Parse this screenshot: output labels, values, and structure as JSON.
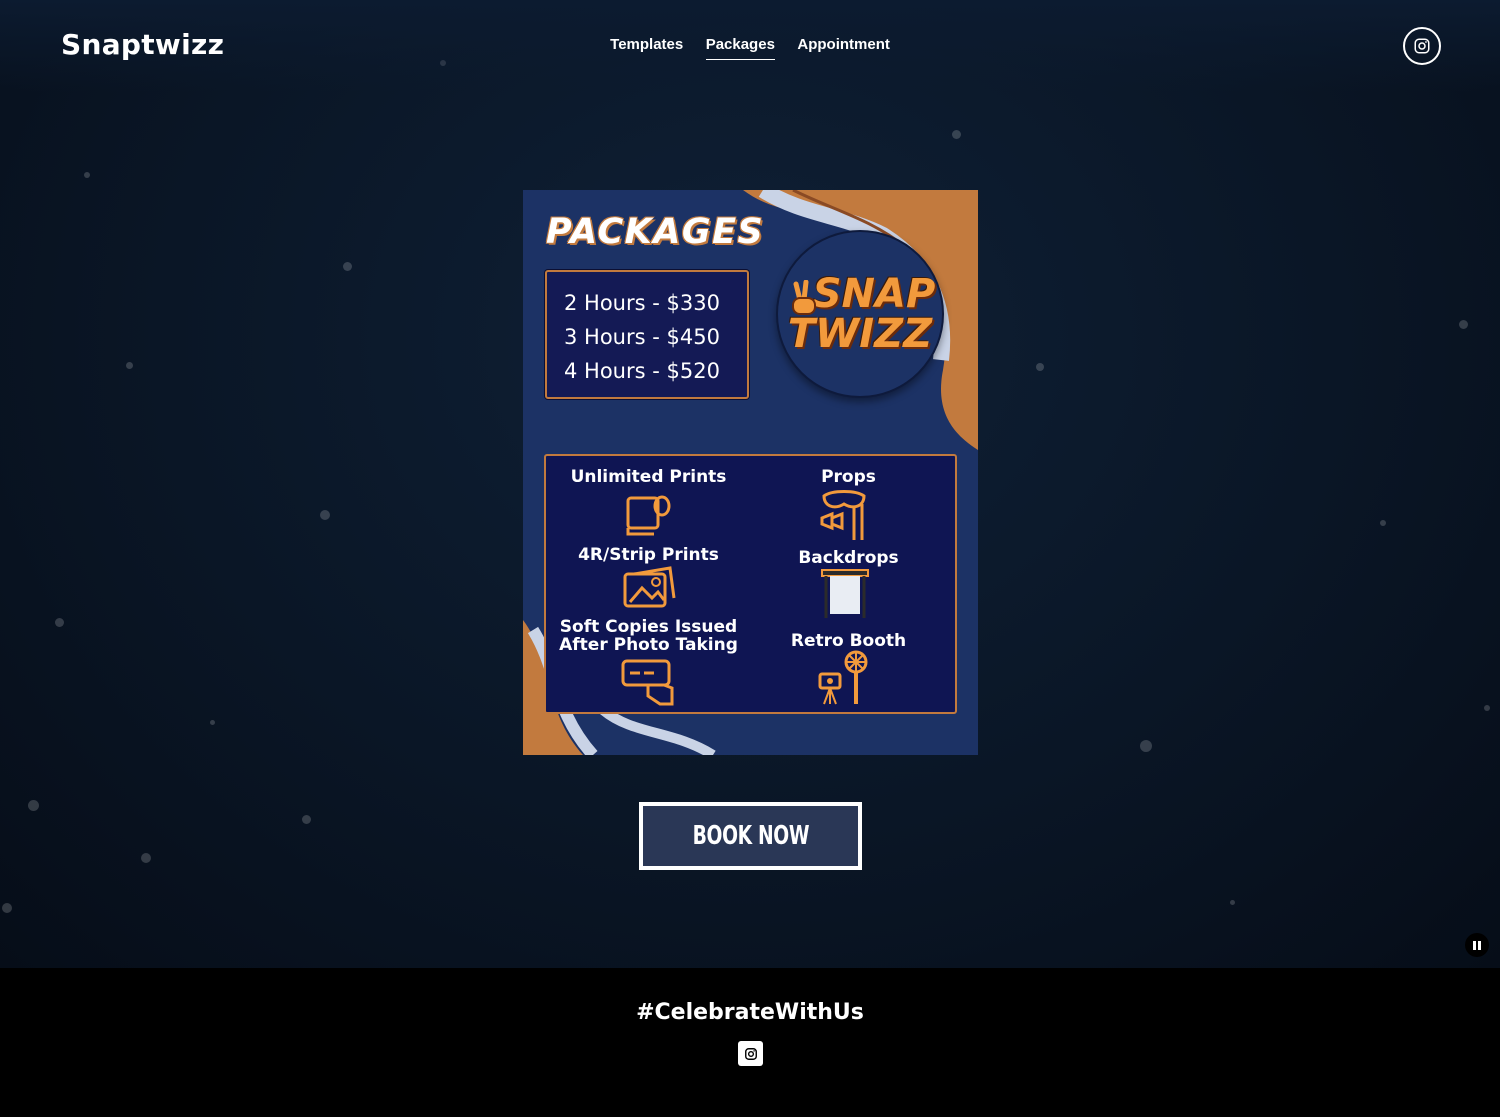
{
  "header": {
    "logo": "Snaptwizz",
    "nav": [
      {
        "label": "Templates",
        "active": false
      },
      {
        "label": "Packages",
        "active": true
      },
      {
        "label": "Appointment",
        "active": false
      }
    ],
    "social_icon": "instagram-icon"
  },
  "flyer": {
    "title": "PACKAGES",
    "prices": [
      "2 Hours - $330",
      "3 Hours - $450",
      "4 Hours - $520"
    ],
    "brand": [
      "SNAP",
      "TWIZZ"
    ],
    "features": [
      {
        "label": "Unlimited Prints",
        "icon": "print-roll-icon"
      },
      {
        "label": "4R/Strip Prints",
        "icon": "photo-icon"
      },
      {
        "label": "Soft Copies Issued After Photo Taking",
        "icon": "phone-hand-icon"
      },
      {
        "label": "Props",
        "icon": "mask-props-icon"
      },
      {
        "label": "Backdrops",
        "icon": "backdrop-icon"
      },
      {
        "label": "Retro Booth",
        "icon": "camera-light-icon"
      }
    ],
    "colors": {
      "background": "#1c3265",
      "accent": "#c27a3e",
      "brand": "#f29a3c",
      "panel": "#0f1553"
    }
  },
  "cta": {
    "label": "BOOK NOW"
  },
  "footer": {
    "hashtag": "#CelebrateWithUs",
    "social_icon": "instagram-icon"
  }
}
